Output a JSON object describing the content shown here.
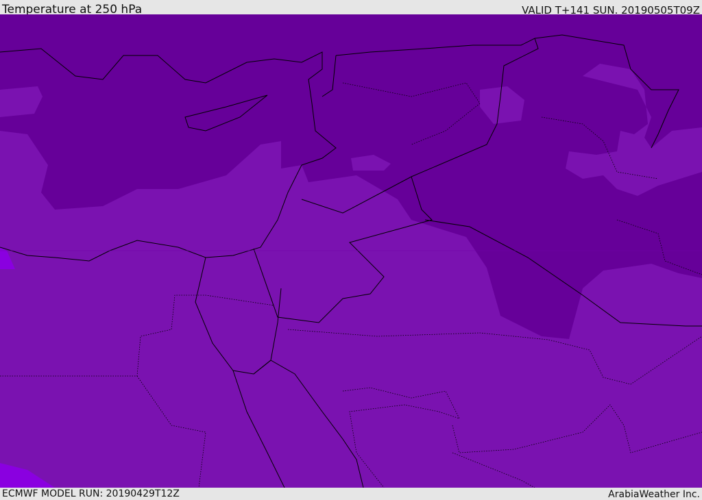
{
  "header": {
    "title": "Temperature at 250 hPa",
    "valid": "VALID T+141 SUN. 20190505T09Z"
  },
  "footer": {
    "model_run": "ECMWF MODEL RUN: 20190429T12Z",
    "brand": "ArabiaWeather Inc."
  },
  "colors": {
    "cold": "#660099",
    "mid": "#7a12b0",
    "warm": "#8420c4",
    "hot": "#8a00e0",
    "border": "#000000"
  }
}
